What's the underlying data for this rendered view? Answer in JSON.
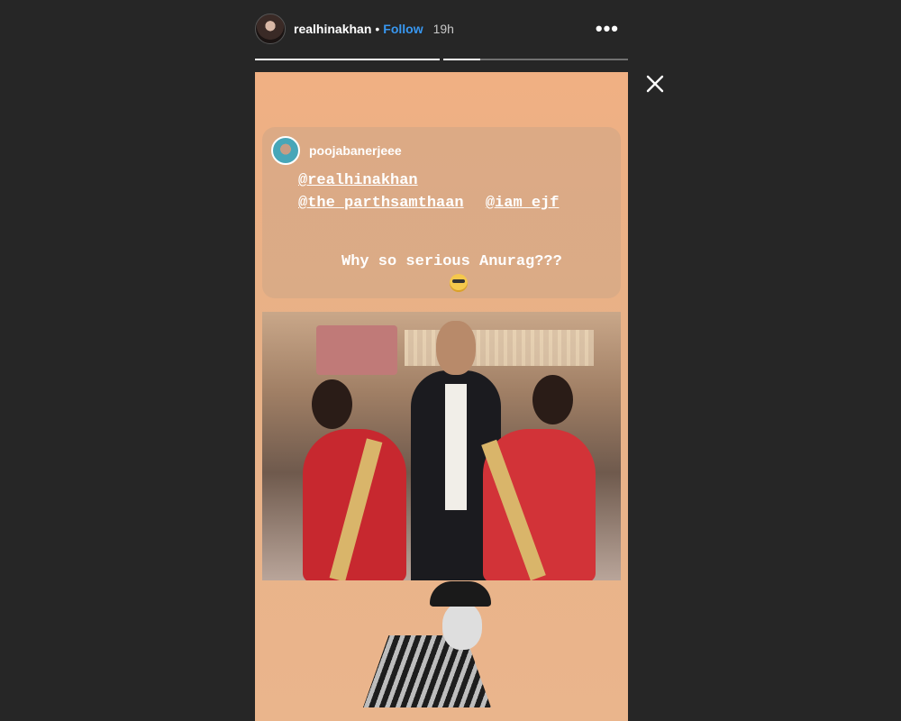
{
  "header": {
    "username": "realhinakhan",
    "separator": "•",
    "follow_label": "Follow",
    "time": "19h",
    "more_label": "•••"
  },
  "progress": {
    "segments": [
      {
        "fraction": 1.0
      },
      {
        "fraction": 0.2
      }
    ]
  },
  "close_icon": "close-icon",
  "story": {
    "reshared_user": "poojabanerjeee",
    "mentions_line1": [
      "@realhinakhan"
    ],
    "mentions_line2": [
      "@the_parthsamthaan",
      "@iam_ejf"
    ],
    "caption": "Why so serious Anurag???",
    "emoji": "nerd-face-emoji"
  },
  "colors": {
    "background": "#262626",
    "story_bg": "#f0b083",
    "follow": "#3897f0"
  }
}
